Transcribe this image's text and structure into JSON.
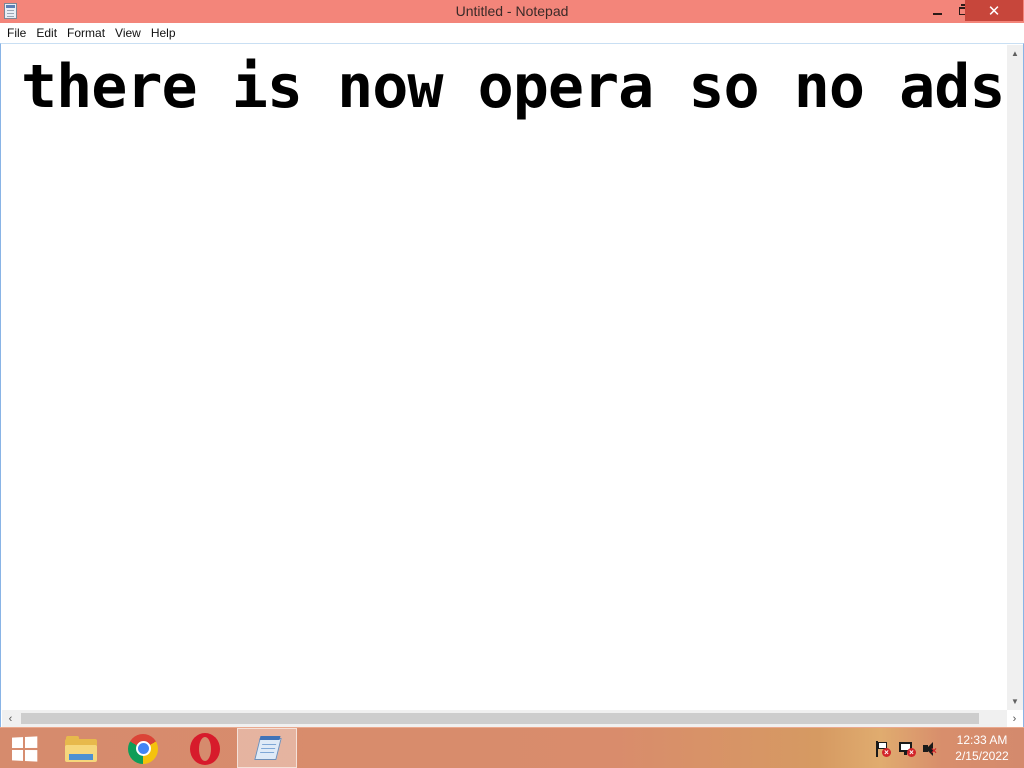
{
  "window": {
    "title": "Untitled - Notepad",
    "controls": {
      "minimize": "minimize-icon",
      "maximize": "restore-icon",
      "close_label": "✕"
    },
    "titlebar_color": "#f3857a",
    "close_color": "#c7463b"
  },
  "menubar": {
    "items": [
      {
        "label": "File"
      },
      {
        "label": "Edit"
      },
      {
        "label": "Format"
      },
      {
        "label": "View"
      },
      {
        "label": "Help"
      }
    ]
  },
  "editor": {
    "text": "there is now opera so no ads"
  },
  "scrollbars": {
    "vertical": {
      "up_arrow": "▲",
      "down_arrow": "▼"
    },
    "horizontal": {
      "left_arrow": "‹",
      "right_arrow": "›"
    }
  },
  "taskbar": {
    "pinned": [
      {
        "name": "start-icon"
      },
      {
        "name": "file-explorer-icon"
      },
      {
        "name": "chrome-icon"
      },
      {
        "name": "opera-icon"
      },
      {
        "name": "notepad-icon",
        "active": true
      }
    ],
    "tray": {
      "icons": [
        "action-center-flag-icon",
        "network-icon",
        "volume-muted-icon"
      ],
      "time": "12:33 AM",
      "date": "2/15/2022"
    },
    "color": "#d68b6d"
  }
}
